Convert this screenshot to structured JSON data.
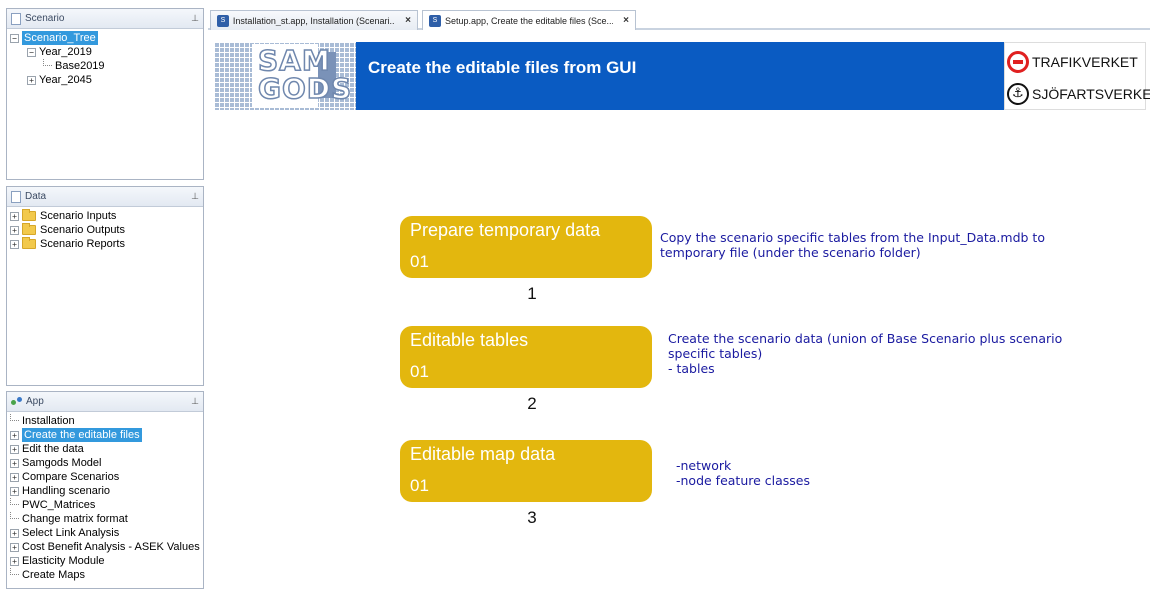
{
  "scenario_panel": {
    "title": "Scenario",
    "tree": {
      "root": "Scenario_Tree",
      "year_2019": "Year_2019",
      "base2019": "Base2019",
      "year_2045": "Year_2045"
    }
  },
  "data_panel": {
    "title": "Data",
    "items": [
      "Scenario Inputs",
      "Scenario Outputs",
      "Scenario Reports"
    ]
  },
  "app_panel": {
    "title": "App",
    "items": [
      {
        "label": "Installation",
        "expandable": false,
        "selected": false
      },
      {
        "label": "Create the editable files",
        "expandable": true,
        "selected": true
      },
      {
        "label": "Edit the data",
        "expandable": true,
        "selected": false
      },
      {
        "label": "Samgods Model",
        "expandable": true,
        "selected": false
      },
      {
        "label": "Compare Scenarios",
        "expandable": true,
        "selected": false
      },
      {
        "label": "Handling scenario",
        "expandable": true,
        "selected": false
      },
      {
        "label": "PWC_Matrices",
        "expandable": false,
        "selected": false
      },
      {
        "label": "Change matrix format",
        "expandable": false,
        "selected": false
      },
      {
        "label": "Select Link Analysis",
        "expandable": true,
        "selected": false
      },
      {
        "label": "Cost Benefit Analysis - ASEK Values",
        "expandable": true,
        "selected": false
      },
      {
        "label": "Elasticity Module",
        "expandable": true,
        "selected": false
      },
      {
        "label": "Create Maps",
        "expandable": false,
        "selected": false
      }
    ]
  },
  "tabs": [
    {
      "label": "Installation_st.app, Installation (Scenari...",
      "active": false
    },
    {
      "label": "Setup.app, Create the editable files (Sce...",
      "active": true
    }
  ],
  "banner": {
    "logo_line1": "SAM",
    "logo_line2": "GODS",
    "title": "Create the editable files from GUI",
    "agency1": "TRAFIKVERKET",
    "agency2": "SJÖFARTSVERKET"
  },
  "steps": [
    {
      "title": "Prepare temporary data",
      "num": "01",
      "label": "1",
      "desc": "Copy the scenario specific tables from the Input_Data.mdb to\ntemporary file (under the scenario folder)"
    },
    {
      "title": "Editable tables",
      "num": "01",
      "label": "2",
      "desc": "Create the scenario data (union of Base Scenario plus scenario\nspecific tables)\n- tables"
    },
    {
      "title": "Editable map data",
      "num": "01",
      "label": "3",
      "desc": "-network\n-node feature classes"
    }
  ],
  "colors": {
    "banner_blue": "#0a5bc2",
    "step_gold": "#e3b70e",
    "desc_blue": "#1a1aa0",
    "selection": "#3399dd"
  }
}
